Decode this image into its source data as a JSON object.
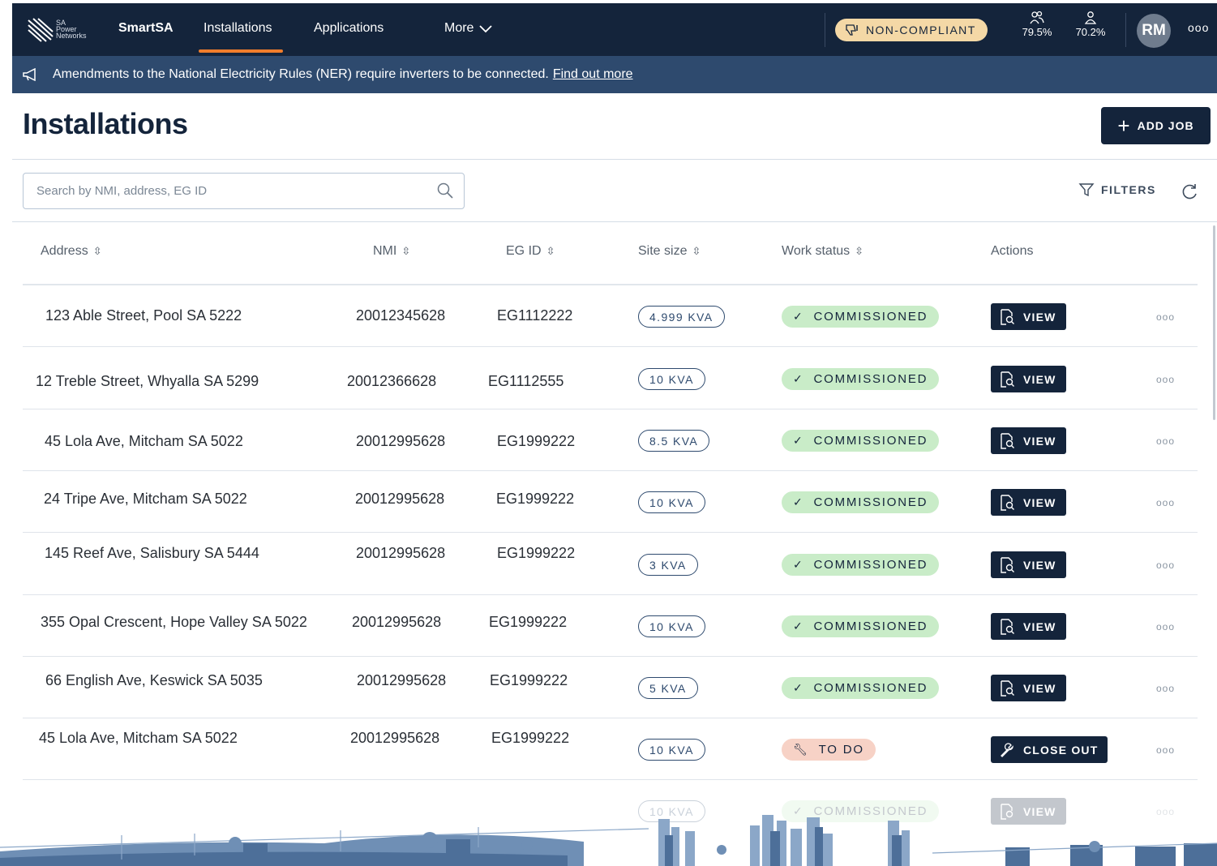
{
  "nav": {
    "logo_text": [
      "SA",
      "Power",
      "Networks"
    ],
    "brand": "SmartSA",
    "installations": "Installations",
    "applications": "Applications",
    "more": "More",
    "compliance_badge": "NON-COMPLIANT",
    "stat1": "79.5%",
    "stat2": "70.2%",
    "avatar_initials": "RM",
    "overflow": "ooo"
  },
  "banner": {
    "text": "Amendments to the National Electricity Rules (NER) require inverters to be connected.",
    "link": "Find out more"
  },
  "page": {
    "title": "Installations",
    "add_job": "ADD JOB"
  },
  "search": {
    "placeholder": "Search by NMI, address, EG ID"
  },
  "filters": {
    "label": "FILTERS"
  },
  "table": {
    "headers": {
      "address": "Address",
      "nmi": "NMI",
      "eg_id": "EG ID",
      "site_size": "Site size",
      "work_status": "Work status",
      "actions": "Actions"
    },
    "rows": [
      {
        "address": "123 Able Street, Pool SA 5222",
        "nmi": "20012345628",
        "eg_id": "EG1112222",
        "size": "4.999 KVA",
        "status": "COMMISSIONED",
        "action": "VIEW",
        "more": "ooo"
      },
      {
        "address": "12 Treble Street, Whyalla SA 5299",
        "nmi": "20012366628",
        "eg_id": "EG1112555",
        "size": "10 KVA",
        "status": "COMMISSIONED",
        "action": "VIEW",
        "more": "ooo"
      },
      {
        "address": "45 Lola Ave, Mitcham SA 5022",
        "nmi": "20012995628",
        "eg_id": "EG1999222",
        "size": "8.5 KVA",
        "status": "COMMISSIONED",
        "action": "VIEW",
        "more": "ooo"
      },
      {
        "address": "24 Tripe Ave, Mitcham SA 5022",
        "nmi": "20012995628",
        "eg_id": "EG1999222",
        "size": "10 KVA",
        "status": "COMMISSIONED",
        "action": "VIEW",
        "more": "ooo"
      },
      {
        "address": "145 Reef Ave, Salisbury SA 5444",
        "nmi": "20012995628",
        "eg_id": "EG1999222",
        "size": "3 KVA",
        "status": "COMMISSIONED",
        "action": "VIEW",
        "more": "ooo"
      },
      {
        "address": "355 Opal Crescent, Hope Valley SA 5022",
        "nmi": "20012995628",
        "eg_id": "EG1999222",
        "size": "10 KVA",
        "status": "COMMISSIONED",
        "action": "VIEW",
        "more": "ooo"
      },
      {
        "address": "66 English Ave, Keswick SA 5035",
        "nmi": "20012995628",
        "eg_id": "EG1999222",
        "size": "5 KVA",
        "status": "COMMISSIONED",
        "action": "VIEW",
        "more": "ooo"
      },
      {
        "address": "45 Lola Ave, Mitcham SA 5022",
        "nmi": "20012995628",
        "eg_id": "EG1999222",
        "size": "10 KVA",
        "status": "TO DO",
        "action": "CLOSE OUT",
        "more": "ooo"
      },
      {
        "address": "",
        "nmi": "",
        "eg_id": "",
        "size": "10 KVA",
        "status": "COMMISSIONED",
        "action": "VIEW",
        "more": "ooo"
      }
    ]
  },
  "colors": {
    "nav_bg": "#14243b",
    "banner_bg": "#2e4a6e",
    "accent_orange": "#f07d2c",
    "status_ok": "#c9ecc8",
    "status_todo": "#f7d2c6",
    "badge_warning": "#f4d8a6"
  },
  "icons": {
    "megaphone": "megaphone-icon",
    "thumbs_down": "thumbs-down-icon",
    "users": "users-icon",
    "user": "user-icon",
    "search": "search-icon",
    "filter": "filter-icon",
    "refresh": "refresh-icon",
    "view": "document-search-icon",
    "wrench": "wrench-icon",
    "check": "check-icon"
  }
}
